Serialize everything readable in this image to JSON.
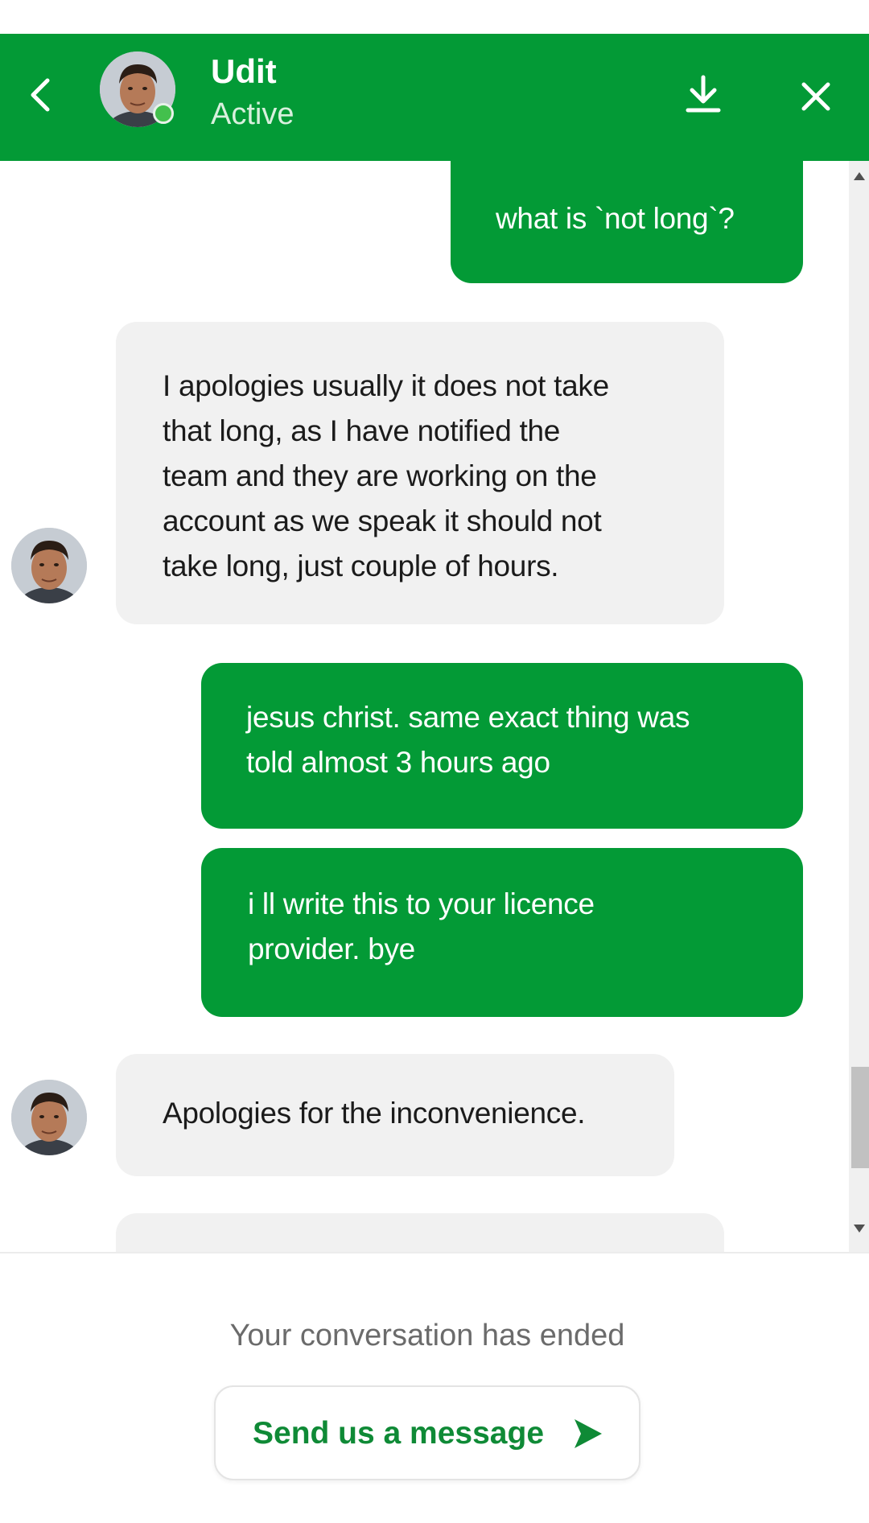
{
  "header": {
    "agent_name": "Udit",
    "agent_status": "Active",
    "brand_color": "#039a36",
    "status_color": "#43c04d",
    "icons": {
      "back": "chevron-left-icon",
      "download": "download-icon",
      "close": "close-icon"
    }
  },
  "messages": [
    {
      "from": "user",
      "text": "what is `not long`?"
    },
    {
      "from": "agent",
      "lines": [
        "I apologies usually it does not take",
        "that long, as I have notified the",
        "team and they are working on the",
        "account as we speak it should not",
        "take long, just couple of hours."
      ]
    },
    {
      "from": "user",
      "lines": [
        "jesus christ. same exact thing was",
        "told almost 3 hours ago"
      ]
    },
    {
      "from": "user",
      "lines": [
        "i ll write this to your licence",
        "provider. bye"
      ]
    },
    {
      "from": "agent",
      "text": "Apologies for the inconvenience."
    }
  ],
  "footer": {
    "ended_text": "Your conversation has ended",
    "send_label": "Send us a message",
    "send_icon": "send-arrow-icon"
  }
}
